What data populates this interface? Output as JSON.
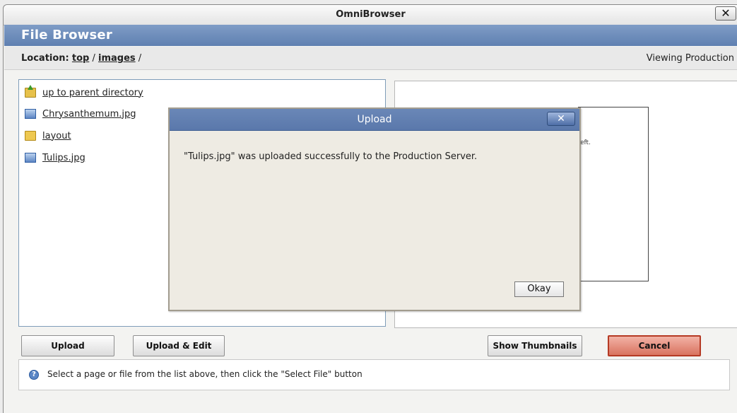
{
  "window": {
    "title": "OmniBrowser",
    "close_glyph": "✕"
  },
  "file_browser": {
    "heading": "File Browser",
    "location": {
      "label": "Location:",
      "crumbs": [
        "top",
        "images"
      ],
      "separator": "/",
      "viewing": "Viewing Production"
    },
    "files": [
      {
        "label": "up to parent directory",
        "icon": "up-folder-icon"
      },
      {
        "label": "Chrysanthemum.jpg",
        "icon": "image-file-icon"
      },
      {
        "label": "layout",
        "icon": "folder-icon"
      },
      {
        "label": "Tulips.jpg",
        "icon": "image-file-icon"
      }
    ],
    "preview_fragment": "eft."
  },
  "buttons": {
    "upload": "Upload",
    "upload_edit": "Upload & Edit",
    "show_thumbnails": "Show Thumbnails",
    "cancel": "Cancel"
  },
  "hint": {
    "icon": "info-icon",
    "text": "Select a page or file from the list above, then click the \"Select File\" button"
  },
  "modal": {
    "title": "Upload",
    "close_glyph": "✕",
    "message": "\"Tulips.jpg\" was uploaded successfully to the Production Server.",
    "ok_label": "Okay"
  },
  "colors": {
    "header_blue": "#6a8abb",
    "cancel_red": "#d9735f",
    "modal_title_blue": "#6a87b7"
  }
}
